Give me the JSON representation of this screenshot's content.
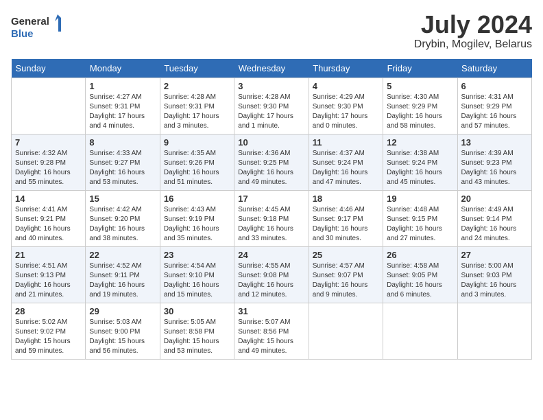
{
  "header": {
    "logo_line1": "General",
    "logo_line2": "Blue",
    "month_year": "July 2024",
    "location": "Drybin, Mogilev, Belarus"
  },
  "days_of_week": [
    "Sunday",
    "Monday",
    "Tuesday",
    "Wednesday",
    "Thursday",
    "Friday",
    "Saturday"
  ],
  "weeks": [
    [
      {
        "day": "",
        "sunrise": "",
        "sunset": "",
        "daylight": ""
      },
      {
        "day": "1",
        "sunrise": "Sunrise: 4:27 AM",
        "sunset": "Sunset: 9:31 PM",
        "daylight": "Daylight: 17 hours and 4 minutes."
      },
      {
        "day": "2",
        "sunrise": "Sunrise: 4:28 AM",
        "sunset": "Sunset: 9:31 PM",
        "daylight": "Daylight: 17 hours and 3 minutes."
      },
      {
        "day": "3",
        "sunrise": "Sunrise: 4:28 AM",
        "sunset": "Sunset: 9:30 PM",
        "daylight": "Daylight: 17 hours and 1 minute."
      },
      {
        "day": "4",
        "sunrise": "Sunrise: 4:29 AM",
        "sunset": "Sunset: 9:30 PM",
        "daylight": "Daylight: 17 hours and 0 minutes."
      },
      {
        "day": "5",
        "sunrise": "Sunrise: 4:30 AM",
        "sunset": "Sunset: 9:29 PM",
        "daylight": "Daylight: 16 hours and 58 minutes."
      },
      {
        "day": "6",
        "sunrise": "Sunrise: 4:31 AM",
        "sunset": "Sunset: 9:29 PM",
        "daylight": "Daylight: 16 hours and 57 minutes."
      }
    ],
    [
      {
        "day": "7",
        "sunrise": "Sunrise: 4:32 AM",
        "sunset": "Sunset: 9:28 PM",
        "daylight": "Daylight: 16 hours and 55 minutes."
      },
      {
        "day": "8",
        "sunrise": "Sunrise: 4:33 AM",
        "sunset": "Sunset: 9:27 PM",
        "daylight": "Daylight: 16 hours and 53 minutes."
      },
      {
        "day": "9",
        "sunrise": "Sunrise: 4:35 AM",
        "sunset": "Sunset: 9:26 PM",
        "daylight": "Daylight: 16 hours and 51 minutes."
      },
      {
        "day": "10",
        "sunrise": "Sunrise: 4:36 AM",
        "sunset": "Sunset: 9:25 PM",
        "daylight": "Daylight: 16 hours and 49 minutes."
      },
      {
        "day": "11",
        "sunrise": "Sunrise: 4:37 AM",
        "sunset": "Sunset: 9:24 PM",
        "daylight": "Daylight: 16 hours and 47 minutes."
      },
      {
        "day": "12",
        "sunrise": "Sunrise: 4:38 AM",
        "sunset": "Sunset: 9:24 PM",
        "daylight": "Daylight: 16 hours and 45 minutes."
      },
      {
        "day": "13",
        "sunrise": "Sunrise: 4:39 AM",
        "sunset": "Sunset: 9:23 PM",
        "daylight": "Daylight: 16 hours and 43 minutes."
      }
    ],
    [
      {
        "day": "14",
        "sunrise": "Sunrise: 4:41 AM",
        "sunset": "Sunset: 9:21 PM",
        "daylight": "Daylight: 16 hours and 40 minutes."
      },
      {
        "day": "15",
        "sunrise": "Sunrise: 4:42 AM",
        "sunset": "Sunset: 9:20 PM",
        "daylight": "Daylight: 16 hours and 38 minutes."
      },
      {
        "day": "16",
        "sunrise": "Sunrise: 4:43 AM",
        "sunset": "Sunset: 9:19 PM",
        "daylight": "Daylight: 16 hours and 35 minutes."
      },
      {
        "day": "17",
        "sunrise": "Sunrise: 4:45 AM",
        "sunset": "Sunset: 9:18 PM",
        "daylight": "Daylight: 16 hours and 33 minutes."
      },
      {
        "day": "18",
        "sunrise": "Sunrise: 4:46 AM",
        "sunset": "Sunset: 9:17 PM",
        "daylight": "Daylight: 16 hours and 30 minutes."
      },
      {
        "day": "19",
        "sunrise": "Sunrise: 4:48 AM",
        "sunset": "Sunset: 9:15 PM",
        "daylight": "Daylight: 16 hours and 27 minutes."
      },
      {
        "day": "20",
        "sunrise": "Sunrise: 4:49 AM",
        "sunset": "Sunset: 9:14 PM",
        "daylight": "Daylight: 16 hours and 24 minutes."
      }
    ],
    [
      {
        "day": "21",
        "sunrise": "Sunrise: 4:51 AM",
        "sunset": "Sunset: 9:13 PM",
        "daylight": "Daylight: 16 hours and 21 minutes."
      },
      {
        "day": "22",
        "sunrise": "Sunrise: 4:52 AM",
        "sunset": "Sunset: 9:11 PM",
        "daylight": "Daylight: 16 hours and 19 minutes."
      },
      {
        "day": "23",
        "sunrise": "Sunrise: 4:54 AM",
        "sunset": "Sunset: 9:10 PM",
        "daylight": "Daylight: 16 hours and 15 minutes."
      },
      {
        "day": "24",
        "sunrise": "Sunrise: 4:55 AM",
        "sunset": "Sunset: 9:08 PM",
        "daylight": "Daylight: 16 hours and 12 minutes."
      },
      {
        "day": "25",
        "sunrise": "Sunrise: 4:57 AM",
        "sunset": "Sunset: 9:07 PM",
        "daylight": "Daylight: 16 hours and 9 minutes."
      },
      {
        "day": "26",
        "sunrise": "Sunrise: 4:58 AM",
        "sunset": "Sunset: 9:05 PM",
        "daylight": "Daylight: 16 hours and 6 minutes."
      },
      {
        "day": "27",
        "sunrise": "Sunrise: 5:00 AM",
        "sunset": "Sunset: 9:03 PM",
        "daylight": "Daylight: 16 hours and 3 minutes."
      }
    ],
    [
      {
        "day": "28",
        "sunrise": "Sunrise: 5:02 AM",
        "sunset": "Sunset: 9:02 PM",
        "daylight": "Daylight: 15 hours and 59 minutes."
      },
      {
        "day": "29",
        "sunrise": "Sunrise: 5:03 AM",
        "sunset": "Sunset: 9:00 PM",
        "daylight": "Daylight: 15 hours and 56 minutes."
      },
      {
        "day": "30",
        "sunrise": "Sunrise: 5:05 AM",
        "sunset": "Sunset: 8:58 PM",
        "daylight": "Daylight: 15 hours and 53 minutes."
      },
      {
        "day": "31",
        "sunrise": "Sunrise: 5:07 AM",
        "sunset": "Sunset: 8:56 PM",
        "daylight": "Daylight: 15 hours and 49 minutes."
      },
      {
        "day": "",
        "sunrise": "",
        "sunset": "",
        "daylight": ""
      },
      {
        "day": "",
        "sunrise": "",
        "sunset": "",
        "daylight": ""
      },
      {
        "day": "",
        "sunrise": "",
        "sunset": "",
        "daylight": ""
      }
    ]
  ]
}
